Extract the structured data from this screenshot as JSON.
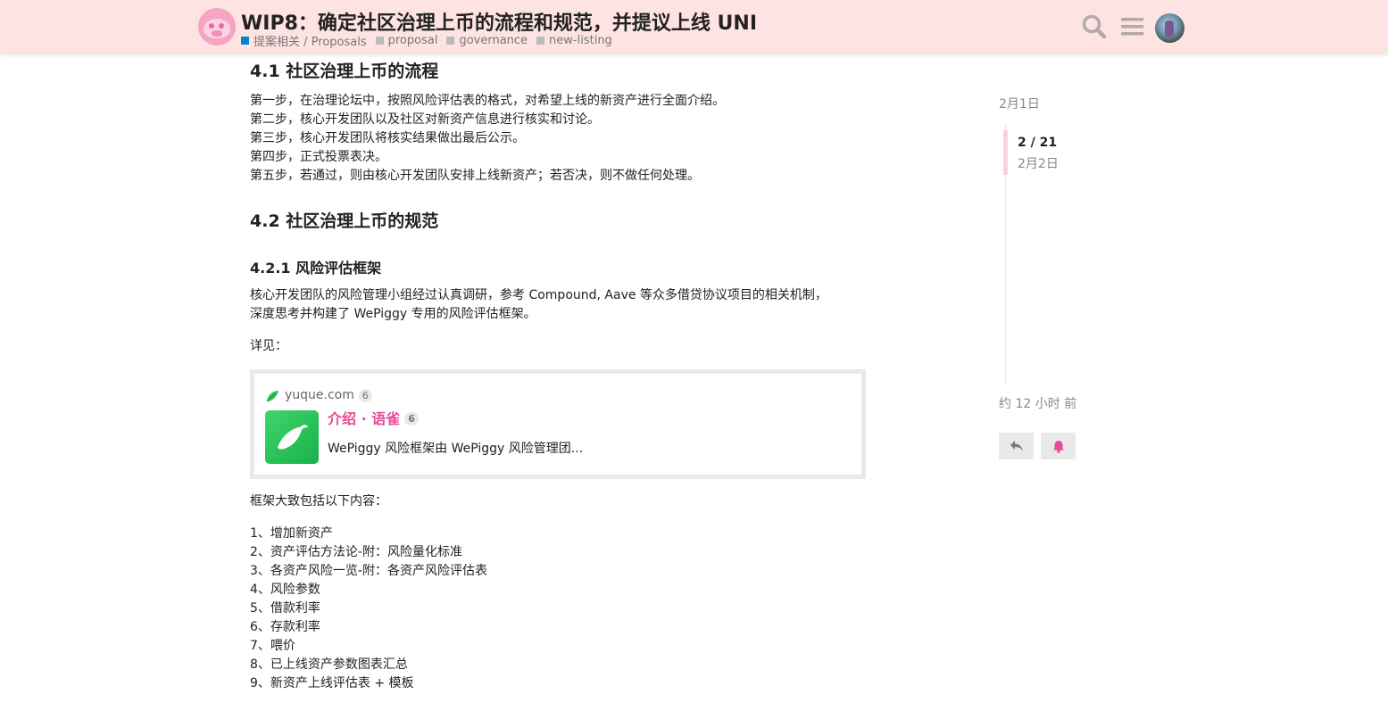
{
  "header": {
    "title": "WIP8：确定社区治理上币的流程和规范，并提议上线 UNI",
    "category": "提案相关 / Proposals",
    "tags": [
      "proposal",
      "governance",
      "new-listing"
    ],
    "colors": {
      "header_bg": "#fde3e1",
      "category": "#0088cc"
    }
  },
  "post": {
    "section_41_title": "4.1 社区治理上币的流程",
    "steps": [
      "第一步，在治理论坛中，按照风险评估表的格式，对希望上线的新资产进行全面介绍。",
      "第二步，核心开发团队以及社区对新资产信息进行核实和讨论。",
      "第三步，核心开发团队将核实结果做出最后公示。",
      "第四步，正式投票表决。",
      "第五步，若通过，则由核心开发团队安排上线新资产；若否决，则不做任何处理。"
    ],
    "section_42_title": "4.2 社区治理上币的规范",
    "section_421_title": "4.2.1 风险评估框架",
    "intro_lines": [
      "核心开发团队的风险管理小组经过认真调研，参考 Compound, Aave 等众多借贷协议项目的相关机制，",
      "深度思考并构建了 WePiggy 专用的风险评估框架。"
    ],
    "see_also": "详见：",
    "onebox": {
      "source": "yuque.com",
      "source_count": "6",
      "title": "介绍 · 语雀",
      "title_count": "6",
      "description": "WePiggy 风险框架由 WePiggy 风险管理团...",
      "colors": {
        "title": "#e54a96",
        "thumb": "#27c35a"
      }
    },
    "framework_intro": "框架大致包括以下内容：",
    "framework_items": [
      "1、增加新资产",
      "2、资产评估方法论-附：风险量化标准",
      "3、各资产风险一览-附：各资产风险评估表",
      "4、风险参数",
      "5、借款利率",
      "6、存款利率",
      "7、喂价",
      "8、已上线资产参数图表汇总",
      "9、新资产上线评估表 + 模板"
    ]
  },
  "timeline": {
    "start_date": "2月1日",
    "position": "2 / 21",
    "current_date": "2月2日",
    "end_label": "约 12 小时 前",
    "colors": {
      "handle": "#fad1df",
      "bell": "#e54a96"
    }
  }
}
